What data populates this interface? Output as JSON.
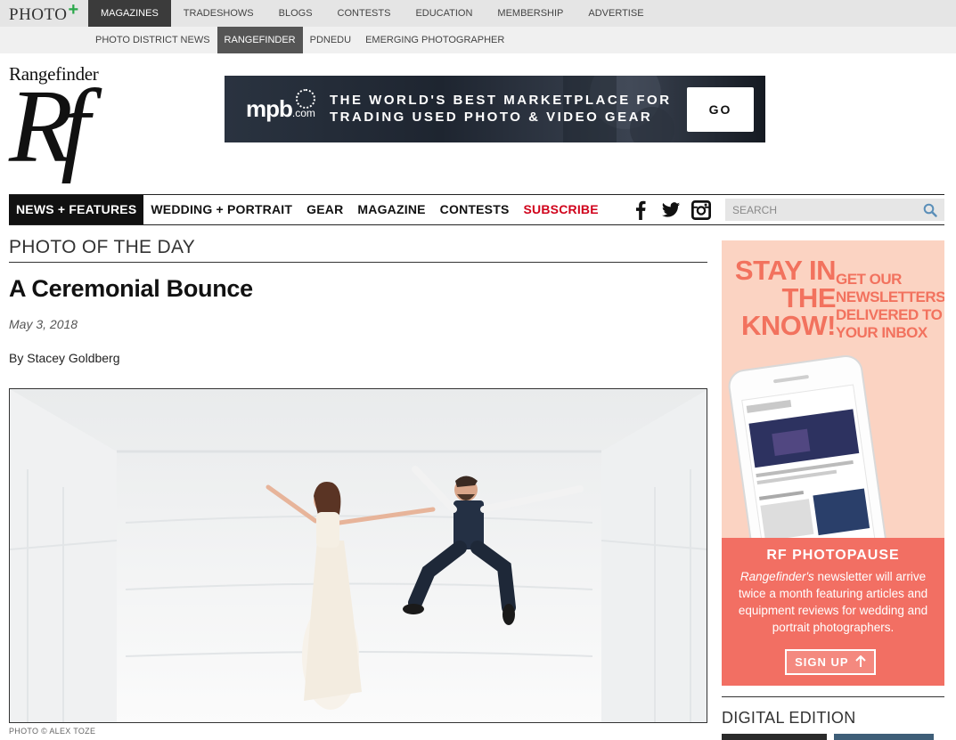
{
  "topbar": {
    "logo_text": "PHOTO",
    "logo_plus": "+",
    "items": [
      "MAGAZINES",
      "TRADESHOWS",
      "BLOGS",
      "CONTESTS",
      "EDUCATION",
      "MEMBERSHIP",
      "ADVERTISE"
    ],
    "active_index": 0
  },
  "subbar": {
    "items": [
      "PHOTO DISTRICT NEWS",
      "RANGEFINDER",
      "PDNEDU",
      "EMERGING PHOTOGRAPHER"
    ],
    "active_index": 1
  },
  "brand": {
    "wordmark": "Rangefinder",
    "monogram": "Rf"
  },
  "ad_banner": {
    "logo": "mpb",
    "logo_suffix": ".com",
    "line1": "THE WORLD'S BEST MARKETPLACE FOR",
    "line2": "TRADING USED PHOTO & VIDEO GEAR",
    "cta": "GO"
  },
  "mainnav": {
    "links": [
      {
        "label": "NEWS + FEATURES",
        "style": "active"
      },
      {
        "label": "WEDDING + PORTRAIT",
        "style": ""
      },
      {
        "label": "GEAR",
        "style": ""
      },
      {
        "label": "MAGAZINE",
        "style": ""
      },
      {
        "label": "CONTESTS",
        "style": ""
      },
      {
        "label": "SUBSCRIBE",
        "style": "red"
      }
    ],
    "social_icons": [
      "facebook-icon",
      "twitter-icon",
      "instagram-icon"
    ],
    "search_placeholder": "SEARCH"
  },
  "article": {
    "section": "PHOTO OF THE DAY",
    "title": "A Ceremonial Bounce",
    "date": "May 3, 2018",
    "byline": "By Stacey Goldberg",
    "photo_credit": "PHOTO © ALEX TOZE"
  },
  "sidebar_ad": {
    "headline": "STAY IN THE KNOW!",
    "subhead": "GET OUR NEWSLETTERS DELIVERED TO YOUR INBOX",
    "newsletter_title": "RF PHOTOPAUSE",
    "body_em": "Rangefinder's",
    "body": " newsletter will arrive twice a month featuring articles and equipment reviews for wedding and portrait photographers.",
    "cta": "SIGN UP"
  },
  "digital_edition": {
    "title": "DIGITAL EDITION"
  },
  "colors": {
    "accent_red": "#d0021b",
    "ad_pink": "#fbd3c2",
    "ad_coral": "#f26f63",
    "plus_green": "#2aa84a"
  }
}
